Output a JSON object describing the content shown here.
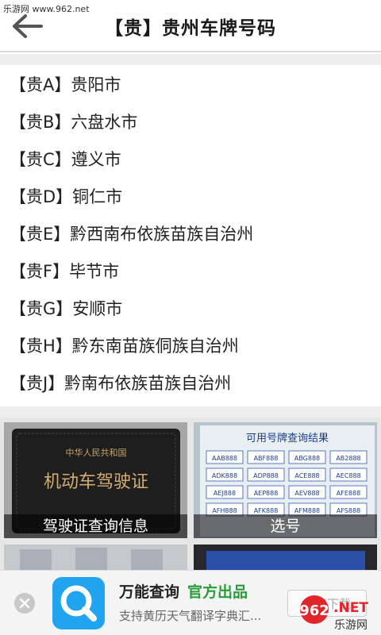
{
  "status": {
    "watermark": "乐游网 www.962.net"
  },
  "header": {
    "title": "【贵】贵州车牌号码",
    "back_icon": "arrow-left-icon"
  },
  "plates": [
    {
      "code": "【贵A】",
      "city": "贵阳市"
    },
    {
      "code": "【贵B】",
      "city": "六盘水市"
    },
    {
      "code": "【贵C】",
      "city": "遵义市"
    },
    {
      "code": "【贵D】",
      "city": "铜仁市"
    },
    {
      "code": "【贵E】",
      "city": "黔西南布依族苗族自治州"
    },
    {
      "code": "【贵F】",
      "city": "毕节市"
    },
    {
      "code": "【贵G】",
      "city": "安顺市"
    },
    {
      "code": "【贵H】",
      "city": "黔东南苗族侗族自治州"
    },
    {
      "code": "【贵J】",
      "city": "黔南布依族苗族自治州"
    }
  ],
  "tiles": [
    {
      "caption": "驾驶证查询信息",
      "image_text": "中华人民共和国",
      "image_text2": "机动车驾驶证"
    },
    {
      "caption": "选号",
      "image_text": "可用号牌查询结果",
      "plates": [
        "AAB888",
        "ABF888",
        "ABG888",
        "AB2888",
        "ADK888",
        "ADP888",
        "ACE888",
        "AEC888",
        "AEJ888",
        "AEP888",
        "AEV888",
        "AFE888",
        "AFH888",
        "AFK888",
        "AFM888",
        "AFS888"
      ]
    }
  ],
  "ad": {
    "name": "万能查询",
    "tag": "官方出品",
    "description": "支持黄历天气翻译字典汇...",
    "button": "立即下载",
    "close_icon": "close-icon",
    "app_icon": "search-icon"
  },
  "logo": {
    "number": "962",
    "suffix": ".NET",
    "site": "乐游网"
  },
  "colors": {
    "ad_tag": "#2a9d3a",
    "app_icon": "#20a4f0",
    "logo_red": "#e0262b"
  }
}
